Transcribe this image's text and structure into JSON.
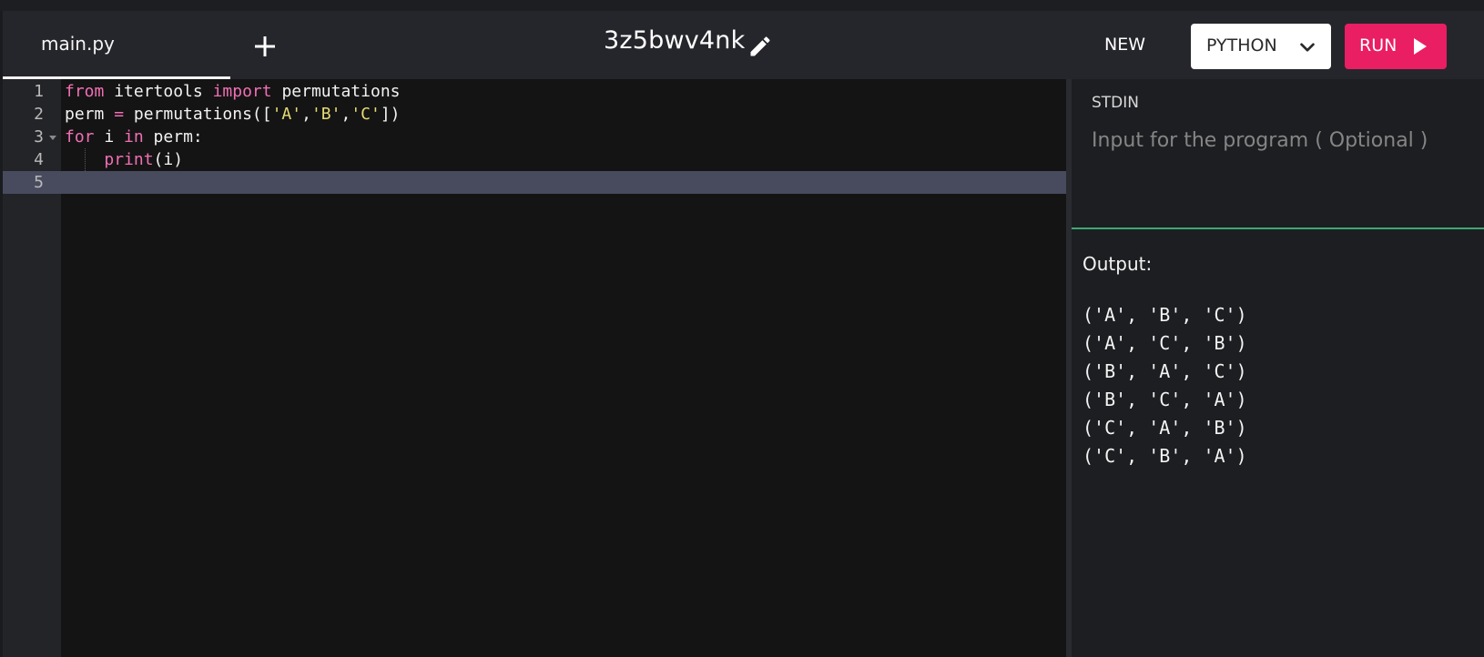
{
  "header": {
    "tab_name": "main.py",
    "add_tab_icon": "plus-icon",
    "title": "3z5bwv4nk",
    "edit_icon": "pencil-icon",
    "new_label": "NEW",
    "language": "PYTHON",
    "language_icon": "chevron-down-icon",
    "run_label": "RUN",
    "run_icon": "play-icon",
    "colors": {
      "run": "#e91e63",
      "tab_underline": "#f2f2f2"
    }
  },
  "editor": {
    "line_numbers": [
      "1",
      "2",
      "3",
      "4",
      "5"
    ],
    "active_line": "5",
    "lines": [
      [
        {
          "t": "kw",
          "v": "from"
        },
        {
          "t": "plain",
          "v": " itertools "
        },
        {
          "t": "kw",
          "v": "import"
        },
        {
          "t": "plain",
          "v": " permutations"
        }
      ],
      [
        {
          "t": "plain",
          "v": "perm "
        },
        {
          "t": "kw",
          "v": "="
        },
        {
          "t": "plain",
          "v": " permutations(["
        },
        {
          "t": "str",
          "v": "'A'"
        },
        {
          "t": "plain",
          "v": ","
        },
        {
          "t": "str",
          "v": "'B'"
        },
        {
          "t": "plain",
          "v": ","
        },
        {
          "t": "str",
          "v": "'C'"
        },
        {
          "t": "plain",
          "v": "])"
        }
      ],
      [
        {
          "t": "kw",
          "v": "for"
        },
        {
          "t": "plain",
          "v": " i "
        },
        {
          "t": "kw",
          "v": "in"
        },
        {
          "t": "plain",
          "v": " perm:"
        }
      ],
      [
        {
          "t": "plain",
          "v": "    "
        },
        {
          "t": "kw",
          "v": "print"
        },
        {
          "t": "plain",
          "v": "(i)"
        }
      ],
      []
    ],
    "colors": {
      "keyword": "#f16fb5",
      "string": "#e6db74",
      "active_line": "#484b5e"
    }
  },
  "stdin": {
    "label": "STDIN",
    "placeholder": "Input for the program ( Optional )",
    "value": "",
    "border_color": "#3fa877"
  },
  "output": {
    "label": "Output:",
    "lines": [
      "('A', 'B', 'C')",
      "('A', 'C', 'B')",
      "('B', 'A', 'C')",
      "('B', 'C', 'A')",
      "('C', 'A', 'B')",
      "('C', 'B', 'A')"
    ]
  }
}
